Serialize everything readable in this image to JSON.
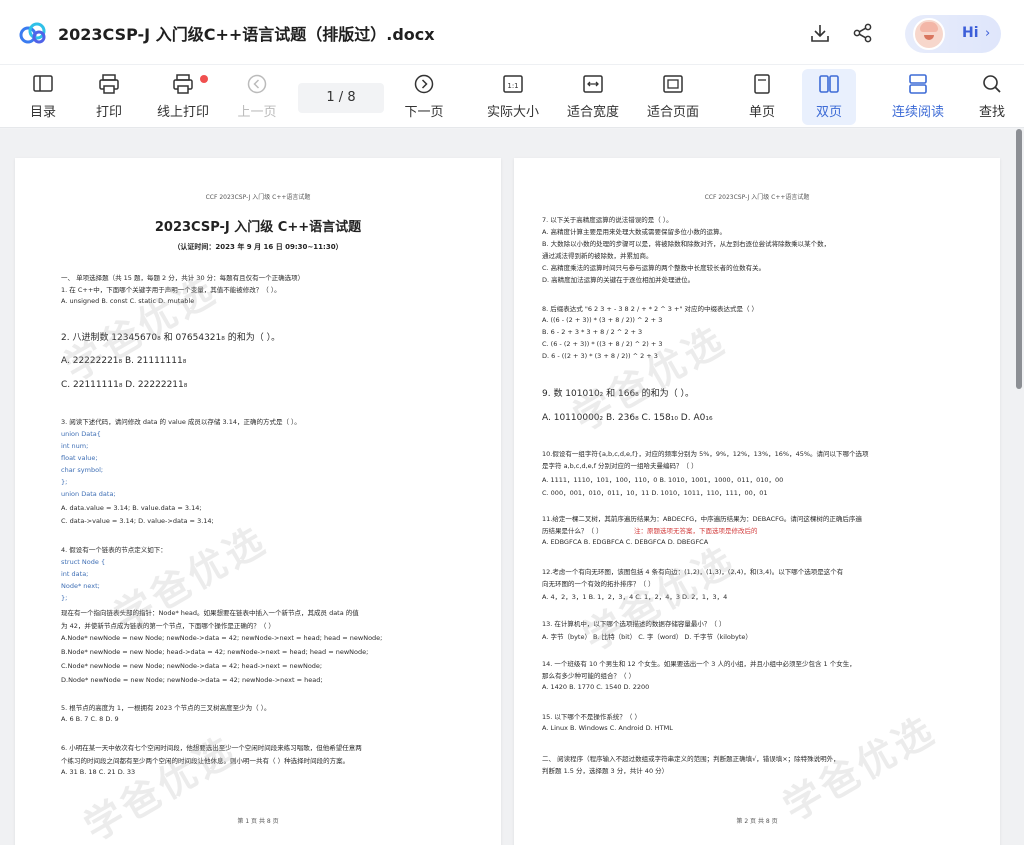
{
  "app": {
    "doc_title": "2023CSP-J 入门级C++语言试题（排版过）.docx",
    "greeting": "Hi",
    "greeting_chevron": "›"
  },
  "toolbar": {
    "items": [
      {
        "label": "目录",
        "icon": "toc-icon"
      },
      {
        "label": "打印",
        "icon": "printer-icon"
      },
      {
        "label": "线上打印",
        "icon": "online-print-icon"
      },
      {
        "label": "上一页",
        "icon": "prev-page-icon"
      },
      {
        "label": "下一页",
        "icon": "next-page-icon"
      },
      {
        "label": "实际大小",
        "icon": "actual-size-icon"
      },
      {
        "label": "适合宽度",
        "icon": "fit-width-icon"
      },
      {
        "label": "适合页面",
        "icon": "fit-page-icon"
      },
      {
        "label": "单页",
        "icon": "single-page-icon"
      },
      {
        "label": "双页",
        "icon": "double-page-icon"
      },
      {
        "label": "连续阅读",
        "icon": "continuous-read-icon"
      },
      {
        "label": "查找",
        "icon": "search-icon"
      }
    ],
    "page_indicator": "1 / 8"
  },
  "watermark": "学爸优选",
  "page1": {
    "header": "CCF 2023CSP-J 入门级 C++语言试题",
    "title": "2023CSP-J 入门级 C++语言试题",
    "subtitle": "（认证时间：2023 年 9 月 16 日 09:30~11:30）",
    "lines": [
      "一、  单项选择题（共 15 题，每题 2 分，共计 30 分：每题有且仅有一个正确选项）",
      "1. 在 C++中，下面哪个关键字用于声明一个变量，其值不能被修改？（ ）。",
      "A.   unsigned        B.   const        C.   static         D.   mutable",
      "2. 八进制数 12345670₈ 和 07654321₈ 的和为（ ）。",
      "A.    22222221₈              B.    21111111₈",
      "C.    22111111₈              D.    22222211₈",
      "3. 阅读下述代码，请问修改 data 的 value 成员以存储 3.14，正确的方式是（ ）。",
      "union Data{",
      "    int num;",
      "    float value;",
      "    char symbol;",
      "};",
      "union Data data;",
      "A. data.value = 3.14;                        B. value.data = 3.14;",
      "C. data->value = 3.14;                       D. value->data = 3.14;",
      "4. 假设有一个链表的节点定义如下：",
      "struct Node {",
      "    int data;",
      "    Node* next;",
      "};",
      "现在有一个指向链表头部的指针：Node* head。如果想要在链表中插入一个新节点，其成员 data 的值",
      "为 42，并使新节点成为链表的第一个节点，下面哪个操作是正确的？（ ）",
      "A.Node* newNode = new Node; newNode->data = 42; newNode->next = head; head = newNode;",
      "B.Node* newNode = new Node; head->data = 42; newNode->next = head; head = newNode;",
      "C.Node* newNode = new Node; newNode->data = 42; head->next = newNode;",
      "D.Node* newNode = new Node; newNode->data = 42; newNode->next = head;",
      "5. 根节点的高度为 1，一根拥有 2023 个节点的三叉树高度至少为（ ）。",
      "A. 6          B. 7          C. 8          D. 9",
      "6. 小明在某一天中依次有七个空闲时间段，他想要选出至少一个空闲时间段来练习唱歌，但他希望任意两",
      "个练习的时间段之间都有至少两个空闲的时间段让他休息。则小明一共有（ ）种选择时间段的方案。",
      "A. 31          B. 18          C. 21          D. 33"
    ],
    "footer": "第 1 页 共 8 页"
  },
  "page2": {
    "header": "CCF 2023CSP-J 入门级 C++语言试题",
    "lines": [
      "7. 以下关于高精度运算的说法错误的是（ ）。",
      "A. 高精度计算主要是用来处理大数或需要保留多位小数的运算。",
      "B. 大数除以小数的处理的步骤可以是，将被除数和除数对齐，从左到右逐位尝试将除数乘以某个数，",
      "通过减法得到新的被除数，并累加商。",
      "C. 高精度乘法的运算时间只与参与运算的两个整数中长度较长者的位数有关。",
      "D. 高精度加法运算的关键在于逐位相加并处理进位。",
      "8. 后缀表达式 \"6 2 3 + - 3 8 2 / + * 2 ^ 3 +\" 对应的中缀表达式是（ ）",
      "A. ((6 - (2 + 3)) * (3 + 8 / 2)) ^ 2 + 3",
      "B. 6 - 2 + 3 * 3 + 8 / 2 ^ 2 + 3",
      "C. (6 - (2 + 3)) * ((3 + 8 / 2) ^ 2) + 3",
      "D. 6 - ((2 + 3) * (3 + 8 / 2)) ^ 2 + 3",
      "9. 数 101010₂ 和 166₈ 的和为（ ）。",
      "A. 10110000₂        B. 236₈        C. 158₁₀        D. A0₁₆",
      "10.假设有一组字符{a,b,c,d,e,f}，对应的频率分别为 5%，9%，12%，13%，16%，45%。请问以下哪个选项",
      "是字符 a,b,c,d,e,f 分别对应的一组哈夫曼编码？（ ）",
      "A.    1111，1110，101，100，110，0          B.    1010，1001，1000，011，010，00",
      "C.    000，001，010，011，10，11            D.    1010，1011，110，111，00，01",
      "11.给定一棵二叉树，其前序遍历结果为：ABDECFG，中序遍历结果为：DEBACFG。请问这棵树的正确后序遍",
      "历结果是什么？（ ）",
      "注：原题选项无答案，下面选项是修改后的",
      "A. EDBGFCA          B. EDGBFCA          C. DEBGFCA          D. DBEGFCA",
      "12.考虑一个有向无环图，该图包括 4 条有向边：(1,2)，(1,3)，(2,4)，和(3,4)。以下哪个选项是这个有",
      "向无环图的一个有效的拓扑排序？（ ）",
      "A. 4，2，3，1          B. 1，2，3，4          C. 1，2，4，3          D. 2，1，3，4",
      "13. 在计算机中，以下哪个选项描述的数据存储容量最小？（ ）",
      "A. 字节（byte）      B. 比特（bit）       C. 字（word）       D. 千字节（kilobyte）",
      "14. 一个班级有 10 个男生和 12 个女生。如果要选出一个 3 人的小组，并且小组中必须至少包含 1 个女生，",
      "那么有多少种可能的组合？（ ）",
      "A. 1420          B. 1770          C. 1540          D. 2200",
      "15. 以下哪个不是操作系统？（ ）",
      "A. Linux          B. Windows          C. Android          D. HTML",
      "二、  阅读程序（程序输入不超过数组或字符串定义的范围；判断题正确填√，错误填×；除特殊说明外，",
      "判断题 1.5 分，选择题 3 分，共计 40 分）"
    ],
    "footer": "第 2 页 共 8 页"
  }
}
